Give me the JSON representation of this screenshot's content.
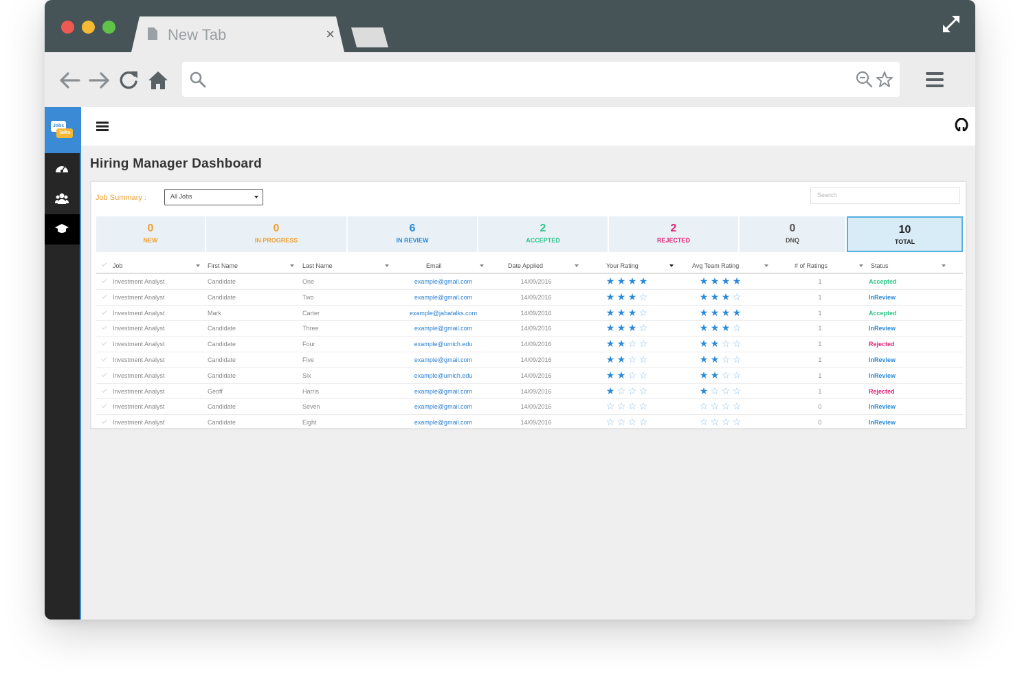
{
  "browser": {
    "tab_title": "New Tab",
    "tab_close": "×",
    "icons": {
      "back": "arrow-left-icon",
      "forward": "arrow-right-icon",
      "reload": "reload-icon",
      "home": "home-icon",
      "search": "search-icon",
      "zoom": "zoom-out-icon",
      "bookmark": "star-icon",
      "menu": "menu-icon",
      "expand": "expand-icon"
    }
  },
  "app": {
    "logo": {
      "top": "Jobs",
      "bottom": "Talks"
    },
    "page_title": "Hiring Manager Dashboard",
    "job_summary_label": "Job Summary :",
    "job_select_value": "All Jobs",
    "search_placeholder": "Search",
    "colors": {
      "accent": "#3b8ad6",
      "new": "#f0a030",
      "inprogress": "#f0a030",
      "inreview": "#2a8ad8",
      "accepted": "#2ec486",
      "rejected": "#e02374",
      "dnq": "#555555",
      "total": "#222222"
    }
  },
  "stats": [
    {
      "value": "0",
      "label": "NEW"
    },
    {
      "value": "0",
      "label": "IN PROGRESS"
    },
    {
      "value": "6",
      "label": "IN REVIEW"
    },
    {
      "value": "2",
      "label": "ACCEPTED"
    },
    {
      "value": "2",
      "label": "REJECTED"
    },
    {
      "value": "0",
      "label": "DNQ"
    },
    {
      "value": "10",
      "label": "TOTAL"
    }
  ],
  "table": {
    "columns": [
      "Job",
      "First Name",
      "Last Name",
      "Email",
      "Date Applied",
      "Your Rating",
      "Avg Team Rating",
      "# of Ratings",
      "Status"
    ],
    "rows": [
      {
        "job": "Investment Analyst",
        "first": "Candidate",
        "last": "One",
        "email": "example@gmail.com",
        "date": "14/09/2016",
        "your_rating": 4,
        "avg_rating": 4,
        "num": "1",
        "status": "Accepted"
      },
      {
        "job": "Investment Analyst",
        "first": "Candidate",
        "last": "Two",
        "email": "example@gmail.com",
        "date": "14/09/2016",
        "your_rating": 3,
        "avg_rating": 3,
        "num": "1",
        "status": "InReview"
      },
      {
        "job": "Investment Analyst",
        "first": "Mark",
        "last": "Carter",
        "email": "example@jabatalks.com",
        "date": "14/09/2016",
        "your_rating": 3,
        "avg_rating": 4,
        "num": "1",
        "status": "Accepted"
      },
      {
        "job": "Investment Analyst",
        "first": "Candidate",
        "last": "Three",
        "email": "example@gmail.com",
        "date": "14/09/2016",
        "your_rating": 3,
        "avg_rating": 3,
        "num": "1",
        "status": "InReview"
      },
      {
        "job": "Investment Analyst",
        "first": "Candidate",
        "last": "Four",
        "email": "example@umich.edu",
        "date": "14/09/2016",
        "your_rating": 2,
        "avg_rating": 2,
        "num": "1",
        "status": "Rejected"
      },
      {
        "job": "Investment Analyst",
        "first": "Candidate",
        "last": "Five",
        "email": "example@gmail.com",
        "date": "14/09/2016",
        "your_rating": 2,
        "avg_rating": 2,
        "num": "1",
        "status": "InReview"
      },
      {
        "job": "Investment Analyst",
        "first": "Candidate",
        "last": "Six",
        "email": "example@umich.edu",
        "date": "14/09/2016",
        "your_rating": 2,
        "avg_rating": 2,
        "num": "1",
        "status": "InReview"
      },
      {
        "job": "Investment Analyst",
        "first": "Geoff",
        "last": "Harris",
        "email": "example@gmail.com",
        "date": "14/09/2016",
        "your_rating": 1,
        "avg_rating": 1,
        "num": "1",
        "status": "Rejected"
      },
      {
        "job": "Investment Analyst",
        "first": "Candidate",
        "last": "Seven",
        "email": "example@gmail.com",
        "date": "14/09/2016",
        "your_rating": 0,
        "avg_rating": 0,
        "num": "0",
        "status": "InReview"
      },
      {
        "job": "Investment Analyst",
        "first": "Candidate",
        "last": "Eight",
        "email": "example@gmail.com",
        "date": "14/09/2016",
        "your_rating": 0,
        "avg_rating": 0,
        "num": "0",
        "status": "InReview"
      }
    ]
  }
}
